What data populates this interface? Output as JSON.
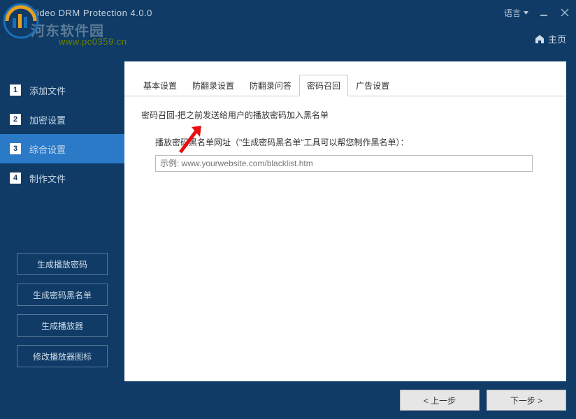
{
  "titlebar": {
    "app_title": "Video DRM Protection 4.0.0",
    "language_label": "语言"
  },
  "watermark": {
    "text": "河东软件园",
    "url": "www.pc0359.cn"
  },
  "header": {
    "home_label": "主页"
  },
  "sidebar": {
    "steps": [
      {
        "num": "1",
        "label": "添加文件"
      },
      {
        "num": "2",
        "label": "加密设置"
      },
      {
        "num": "3",
        "label": "综合设置"
      },
      {
        "num": "4",
        "label": "制作文件"
      }
    ],
    "buttons": {
      "gen_play_pwd": "生成播放密码",
      "gen_blacklist": "生成密码黑名单",
      "gen_player": "生成播放器",
      "mod_icon": "修改播放器图标"
    }
  },
  "tabs": {
    "basic": "基本设置",
    "anti_record": "防翻录设置",
    "anti_qa": "防翻录问答",
    "pwd_recall": "密码召回",
    "ad": "广告设置"
  },
  "content": {
    "description": "密码召回-把之前发送给用户的播放密码加入黑名单",
    "field_label": "播放密码黑名单网址（\"生成密码黑名单\"工具可以帮您制作黑名单）：",
    "placeholder": "示例: www.yourwebsite.com/blacklist.htm"
  },
  "footer": {
    "prev": "< 上一步",
    "next": "下一步 >"
  }
}
